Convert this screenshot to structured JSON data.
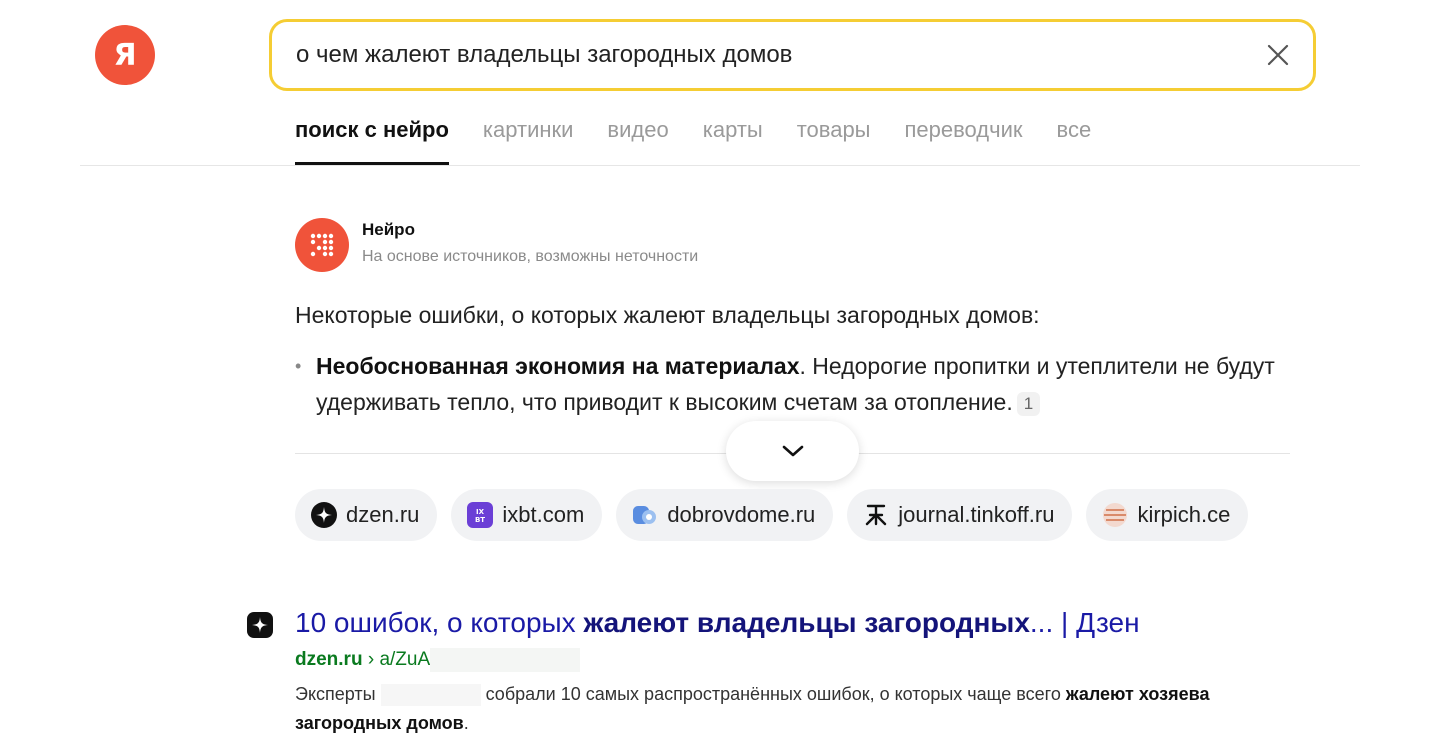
{
  "logo": {
    "text": "Я"
  },
  "search": {
    "query": "о чем жалеют владельцы загородных домов"
  },
  "tabs": [
    {
      "label": "поиск с нейро",
      "active": true
    },
    {
      "label": "картинки"
    },
    {
      "label": "видео"
    },
    {
      "label": "карты"
    },
    {
      "label": "товары"
    },
    {
      "label": "переводчик"
    },
    {
      "label": "все"
    }
  ],
  "neuro": {
    "name": "Нейро",
    "subtitle": "На основе источников, возможны неточности",
    "intro": "Некоторые ошибки, о которых жалеют владельцы загородных домов:",
    "items": [
      {
        "bullet": "•",
        "bold": "Необоснованная экономия на материалах",
        "text": ". Недорогие пропитки и утеплители не будут удерживать тепло, что приводит к высоким счетам за отопление.",
        "ref": "1"
      }
    ]
  },
  "sources": [
    {
      "label": "dzen.ru",
      "icon": "dzen-icon"
    },
    {
      "label": "ixbt.com",
      "icon": "ixbt-icon"
    },
    {
      "label": "dobrovdome.ru",
      "icon": "dobrovdome-icon"
    },
    {
      "label": "journal.tinkoff.ru",
      "icon": "tinkoff-icon"
    },
    {
      "label": "kirpich.ce",
      "icon": "kirpich-icon"
    }
  ],
  "result": {
    "title_pre": "10 ошибок, о которых ",
    "title_bold": "жалеют владельцы загородных",
    "title_post": "... | Дзен",
    "url_domain": "dzen.ru",
    "url_sep": " › ",
    "url_path": "a/ZuA",
    "snippet_pre": "Эксперты",
    "snippet_mid": "собрали 10 самых распространённых ошибок, о которых чаще всего ",
    "snippet_bold1": "жалеют",
    "snippet_bold2": "хозяева загородных домов",
    "snippet_post": "."
  },
  "colors": {
    "accent": "#f0533a",
    "search_border": "#f5cd34",
    "link": "#1a1aa6",
    "url": "#0a7a1f"
  }
}
